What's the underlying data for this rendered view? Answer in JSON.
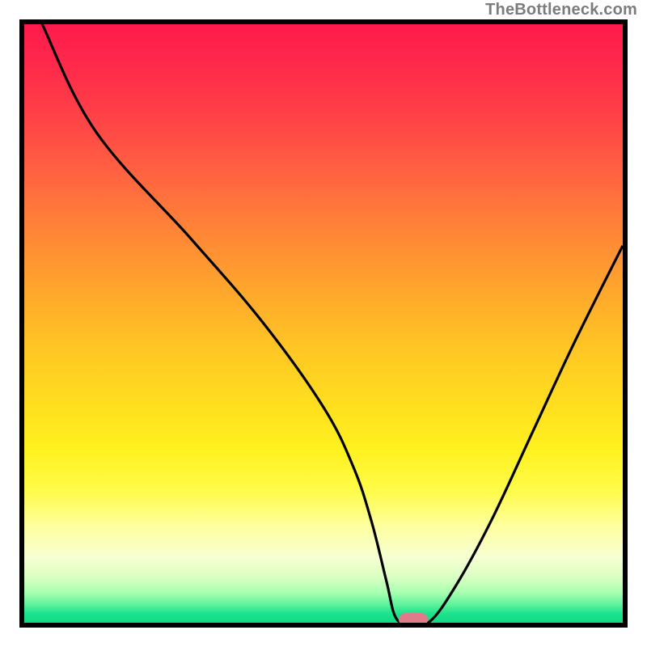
{
  "watermark": "TheBottleneck.com",
  "chart_data": {
    "type": "line",
    "title": "",
    "xlabel": "",
    "ylabel": "",
    "xlim": [
      0,
      100
    ],
    "ylim": [
      0,
      100
    ],
    "grid": false,
    "legend": false,
    "x": [
      3,
      12,
      28,
      40,
      50,
      55,
      58,
      60.5,
      62,
      64,
      67.5,
      72,
      78,
      85,
      92,
      100
    ],
    "y": [
      100,
      82,
      64,
      50,
      36,
      26,
      17,
      7,
      1,
      0,
      0,
      6,
      17,
      32,
      47,
      63
    ],
    "marker": {
      "x": 65,
      "y": 0.5
    },
    "background_gradient": {
      "top": "#ff1a4d",
      "mid": "#ffdd1f",
      "bottom": "#12d884"
    }
  }
}
